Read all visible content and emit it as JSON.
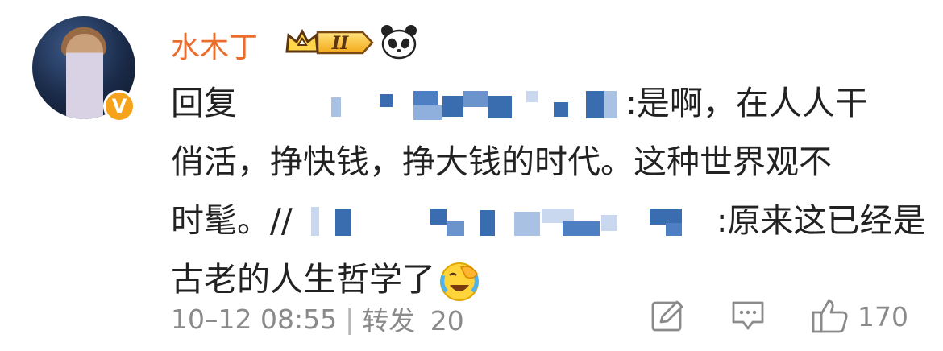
{
  "user": {
    "name": "水木丁",
    "verified_badge": "V",
    "vip_level": "II",
    "avatar_icon": "avatar-icon",
    "panda_icon": "panda-icon"
  },
  "post": {
    "line1_prefix": "回复",
    "line1_suffix": ":是啊，在人人干",
    "line2": "俏活，挣快钱，挣大钱的时代。这种世界观不",
    "line3_prefix": "时髦。//",
    "line3_suffix": ":原来这已经是",
    "line4": "古老的人生哲学了",
    "emoji": "laugh-cry-emoji"
  },
  "footer": {
    "time": "10–12 08:55",
    "divider": "|",
    "repost_label": "转发",
    "repost_count": "20",
    "like_count": "170"
  },
  "colors": {
    "username": "#eb6d2c",
    "meta": "#8a8a8a",
    "mosaic": "#3a6cb0"
  }
}
